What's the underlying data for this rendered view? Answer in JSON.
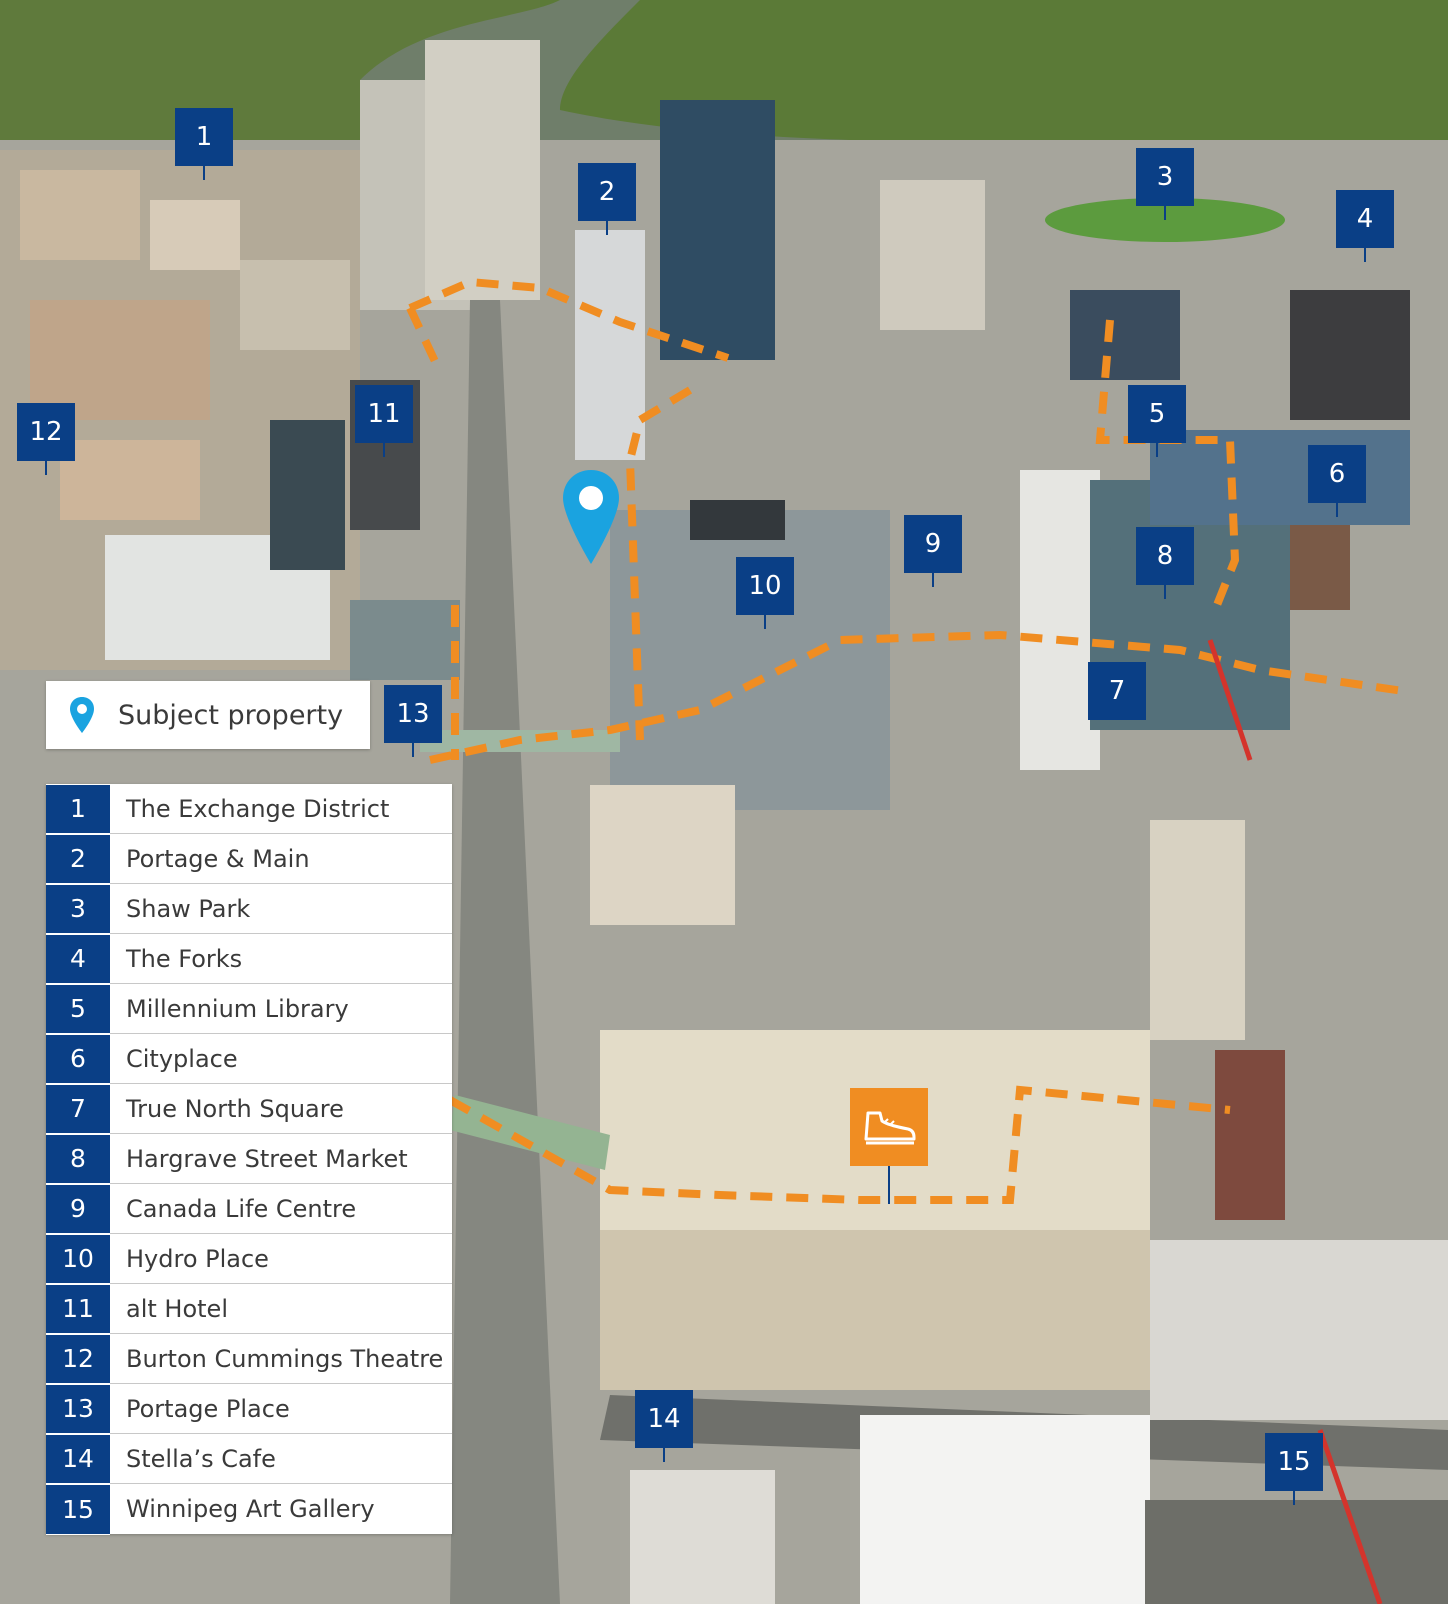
{
  "subject": {
    "label": "Subject property",
    "icon": "location-pin-icon"
  },
  "markers": [
    {
      "id": "1",
      "label": "1"
    },
    {
      "id": "2",
      "label": "2"
    },
    {
      "id": "3",
      "label": "3"
    },
    {
      "id": "4",
      "label": "4"
    },
    {
      "id": "5",
      "label": "5"
    },
    {
      "id": "6",
      "label": "6"
    },
    {
      "id": "7",
      "label": "7"
    },
    {
      "id": "8",
      "label": "8"
    },
    {
      "id": "9",
      "label": "9"
    },
    {
      "id": "10",
      "label": "10"
    },
    {
      "id": "11",
      "label": "11"
    },
    {
      "id": "12",
      "label": "12"
    },
    {
      "id": "13",
      "label": "13"
    },
    {
      "id": "14",
      "label": "14"
    },
    {
      "id": "15",
      "label": "15"
    }
  ],
  "legend": [
    {
      "num": "1",
      "name": "The Exchange District"
    },
    {
      "num": "2",
      "name": "Portage & Main"
    },
    {
      "num": "3",
      "name": "Shaw Park"
    },
    {
      "num": "4",
      "name": "The Forks"
    },
    {
      "num": "5",
      "name": "Millennium Library"
    },
    {
      "num": "6",
      "name": "Cityplace"
    },
    {
      "num": "7",
      "name": "True North Square"
    },
    {
      "num": "8",
      "name": "Hargrave Street Market"
    },
    {
      "num": "9",
      "name": "Canada Life Centre"
    },
    {
      "num": "10",
      "name": "Hydro Place"
    },
    {
      "num": "11",
      "name": "alt Hotel"
    },
    {
      "num": "12",
      "name": "Burton Cummings Theatre"
    },
    {
      "num": "13",
      "name": "Portage Place"
    },
    {
      "num": "14",
      "name": "Stella’s Cafe"
    },
    {
      "num": "15",
      "name": "Winnipeg Art Gallery"
    }
  ],
  "walkway_icon": "walking-shoe-icon",
  "colors": {
    "marker": "#0a3f86",
    "subject_pin": "#1aa3e0",
    "walkway_route": "#f08d22"
  }
}
